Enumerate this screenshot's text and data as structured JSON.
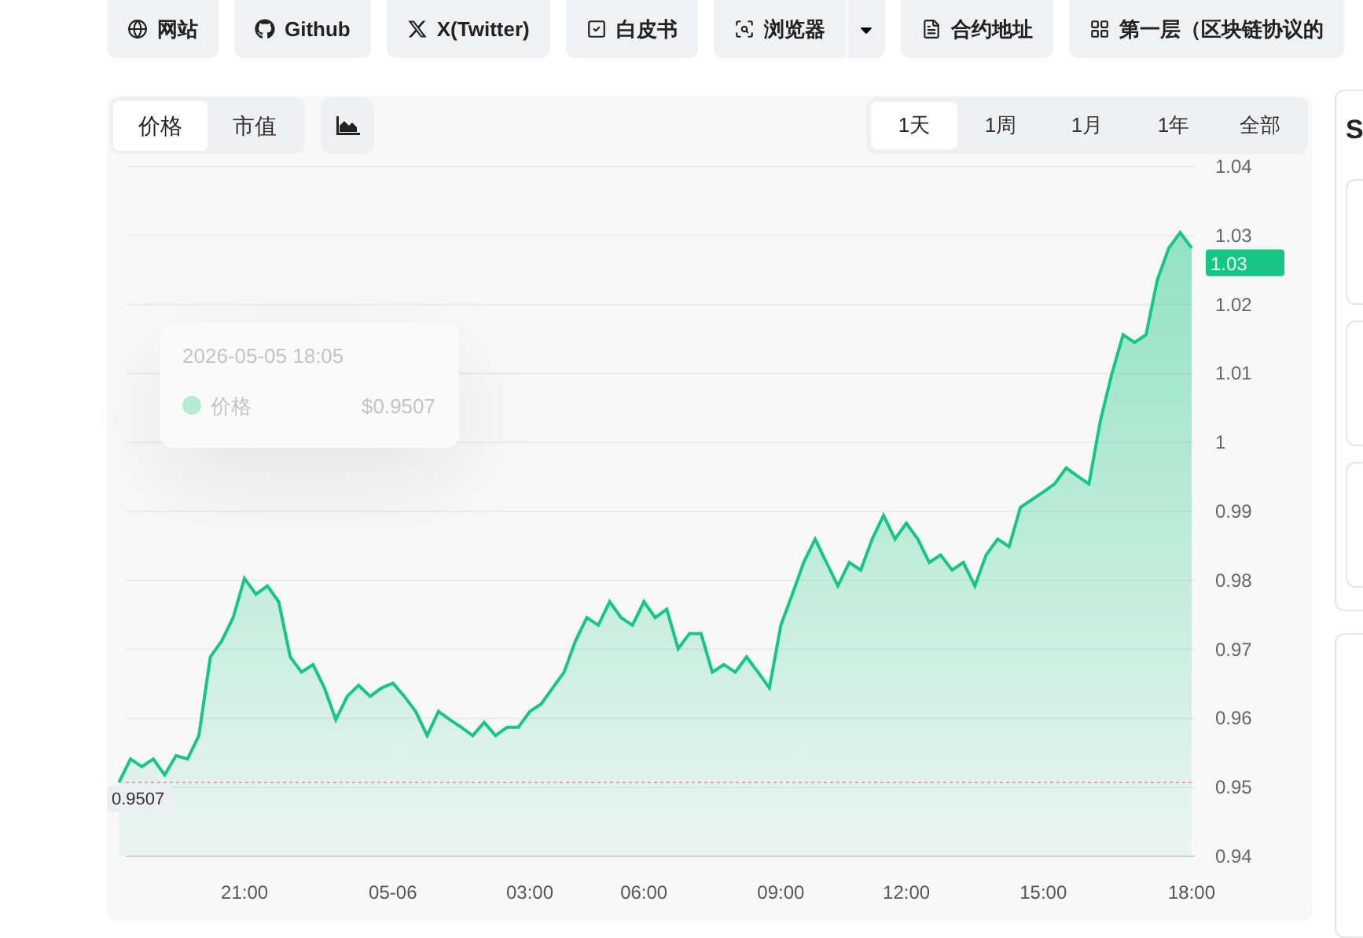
{
  "links": [
    {
      "label": "网站",
      "dropdown": false
    },
    {
      "label": "Github",
      "dropdown": false
    },
    {
      "label": "X(Twitter)",
      "dropdown": false
    },
    {
      "label": "白皮书",
      "dropdown": false
    },
    {
      "label": "浏览器",
      "dropdown": true
    },
    {
      "label": "合约地址",
      "dropdown": false
    },
    {
      "label": "第一层（区块链协议的",
      "dropdown": false
    }
  ],
  "metric_tabs": [
    {
      "label": "价格",
      "selected": true
    },
    {
      "label": "市值",
      "selected": false
    }
  ],
  "range_tabs": [
    {
      "label": "1天",
      "selected": true
    },
    {
      "label": "1周",
      "selected": false
    },
    {
      "label": "1月",
      "selected": false
    },
    {
      "label": "1年",
      "selected": false
    },
    {
      "label": "全部",
      "selected": false
    }
  ],
  "tooltip": {
    "time": "2026-05-05 18:05",
    "series": "价格",
    "value": "$0.9507"
  },
  "chart_data": {
    "type": "area",
    "grid": true,
    "ylim": [
      0.94,
      1.04
    ],
    "categories": [
      null,
      null,
      null,
      null,
      null,
      null,
      null,
      null,
      null,
      null,
      null,
      "21:00",
      null,
      null,
      null,
      null,
      null,
      null,
      null,
      null,
      null,
      null,
      null,
      null,
      "05-06",
      null,
      null,
      null,
      null,
      null,
      null,
      null,
      null,
      null,
      null,
      null,
      "03:00",
      null,
      null,
      null,
      null,
      null,
      null,
      null,
      null,
      null,
      "06:00",
      null,
      null,
      null,
      null,
      null,
      null,
      null,
      null,
      null,
      null,
      null,
      "09:00",
      null,
      null,
      null,
      null,
      null,
      null,
      null,
      null,
      null,
      null,
      "12:00",
      null,
      null,
      null,
      null,
      null,
      null,
      null,
      null,
      null,
      null,
      null,
      "15:00",
      null,
      null,
      null,
      null,
      null,
      null,
      null,
      null,
      null,
      null,
      null,
      null,
      "18:00"
    ],
    "yticks": [
      0.94,
      0.95,
      0.96,
      0.97,
      0.98,
      0.99,
      1,
      1.01,
      1.02,
      1.03,
      1.04
    ],
    "series": [
      {
        "color": "#16c784",
        "values": [
          0.9507,
          0.9541,
          0.953,
          0.9541,
          0.9518,
          0.9546,
          0.9541,
          0.9575,
          0.9689,
          0.9712,
          0.9746,
          0.9803,
          0.978,
          0.9792,
          0.9769,
          0.9689,
          0.9667,
          0.9678,
          0.9644,
          0.9598,
          0.9632,
          0.9648,
          0.9632,
          0.9644,
          0.9651,
          0.9632,
          0.961,
          0.9575,
          0.961,
          0.9598,
          0.9587,
          0.9575,
          0.9594,
          0.9575,
          0.9587,
          0.9587,
          0.961,
          0.9621,
          0.9644,
          0.9667,
          0.9712,
          0.9746,
          0.9735,
          0.9769,
          0.9746,
          0.9735,
          0.9769,
          0.9746,
          0.9758,
          0.9701,
          0.9723,
          0.9723,
          0.9667,
          0.9678,
          0.9667,
          0.9689,
          0.9667,
          0.9644,
          0.9735,
          0.978,
          0.9826,
          0.986,
          0.9826,
          0.9792,
          0.9826,
          0.9815,
          0.986,
          0.9894,
          0.986,
          0.9883,
          0.986,
          0.9826,
          0.9837,
          0.9815,
          0.9826,
          0.9792,
          0.9837,
          0.986,
          0.9849,
          0.9906,
          0.9917,
          0.9928,
          0.994,
          0.9963,
          0.9951,
          0.994,
          1.0031,
          1.0099,
          1.0156,
          1.0145,
          1.0156,
          1.0236,
          1.0282,
          1.0304,
          1.0282
        ]
      }
    ],
    "annotations": [
      "1.03"
    ],
    "ref_lines": [
      {
        "axis": "y",
        "value": 0.9507,
        "label": "0.9507"
      }
    ]
  },
  "side_panel": {
    "title": "S"
  }
}
